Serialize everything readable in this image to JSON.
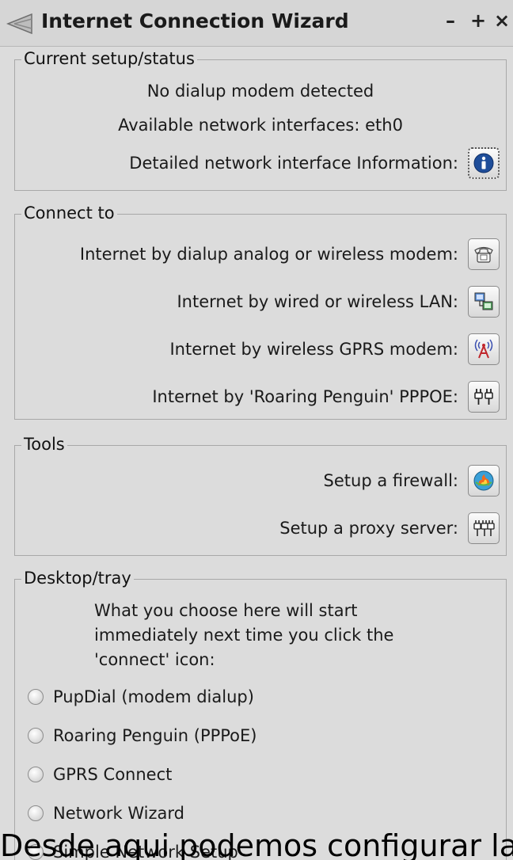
{
  "window": {
    "title": "Internet Connection Wizard",
    "controls": {
      "minimize": "–",
      "maximize": "+",
      "close": "×"
    }
  },
  "status": {
    "label": "Current setup/status",
    "modem": "No dialup modem detected",
    "interfaces": "Available network interfaces: eth0",
    "detail_label": "Detailed network interface Information:",
    "detail_icon": "info-icon"
  },
  "connect": {
    "label": "Connect to",
    "items": [
      {
        "label": "Internet by dialup analog or wireless modem:",
        "icon": "telephone-icon"
      },
      {
        "label": "Internet by wired or wireless LAN:",
        "icon": "network-computers-icon"
      },
      {
        "label": "Internet by wireless GPRS modem:",
        "icon": "antenna-icon"
      },
      {
        "label": "Internet by 'Roaring Penguin' PPPOE:",
        "icon": "plug-icon"
      }
    ]
  },
  "tools": {
    "label": "Tools",
    "items": [
      {
        "label": "Setup a firewall:",
        "icon": "firewall-icon"
      },
      {
        "label": "Setup a proxy server:",
        "icon": "proxy-icon"
      }
    ]
  },
  "desktop": {
    "label": "Desktop/tray",
    "description": [
      "What you choose here will start",
      "immediately next time you click the",
      "'connect' icon:"
    ],
    "options": [
      "PupDial (modem dialup)",
      "Roaring Penguin (PPPoE)",
      "GPRS Connect",
      "Network Wizard",
      "Simple Network Setup"
    ]
  },
  "caption": "Desde aqui podemos configurar la red de mo"
}
